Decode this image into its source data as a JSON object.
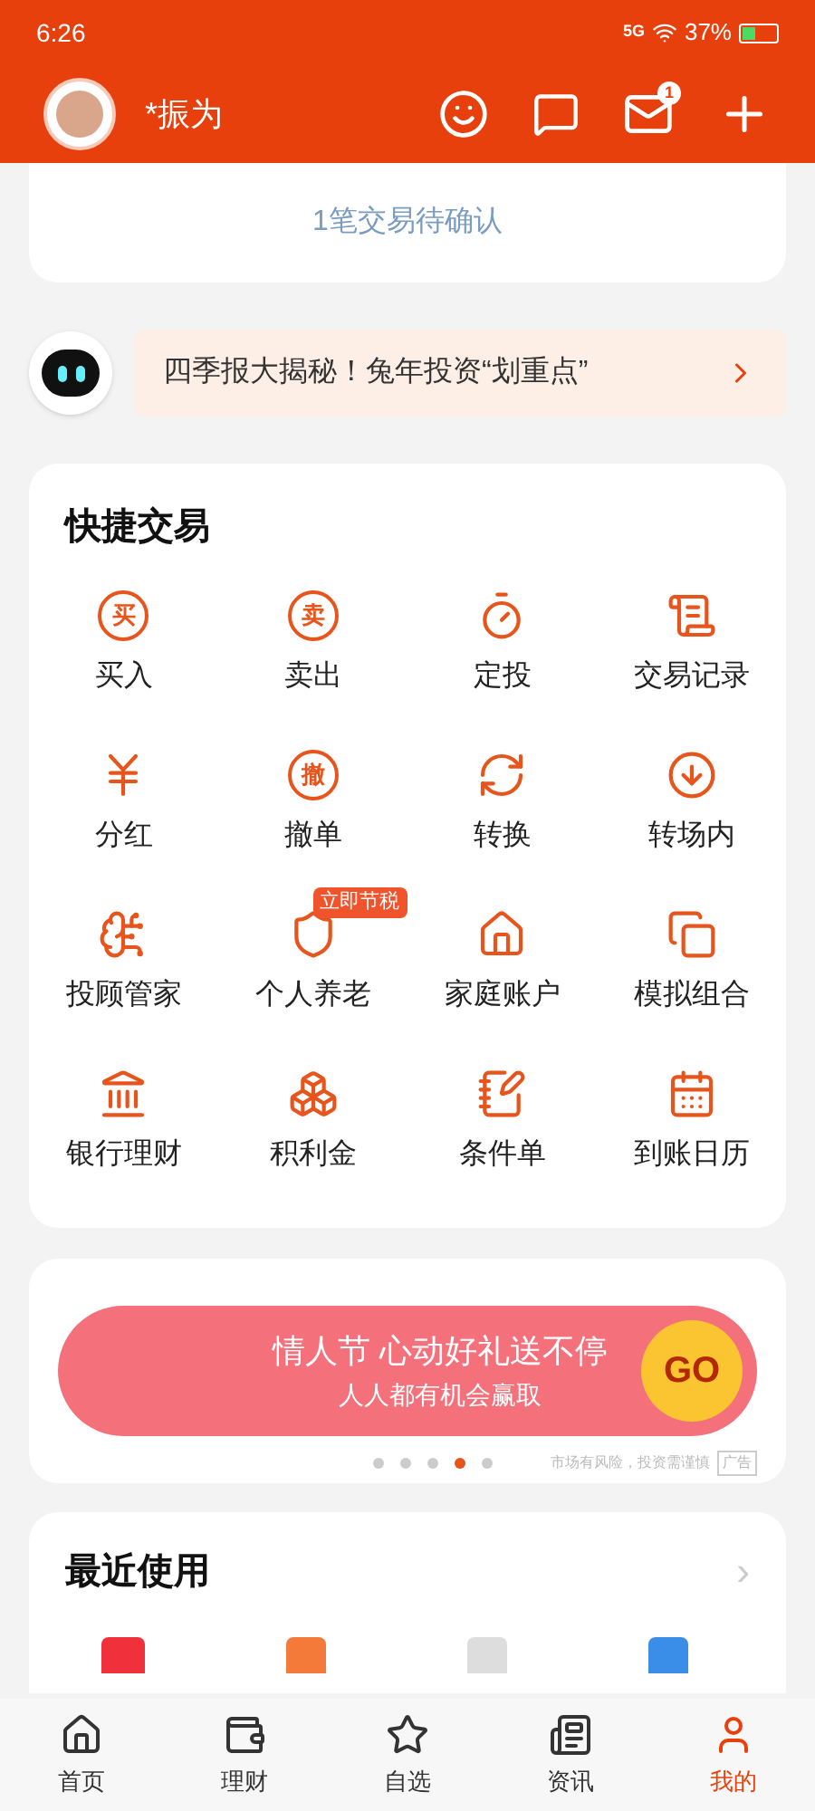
{
  "status_bar": {
    "time": "6:26",
    "network": "5G",
    "battery": "37%"
  },
  "header": {
    "username": "*振为",
    "mail_badge": "1"
  },
  "pending_card": {
    "text": "1笔交易待确认"
  },
  "robot_banner": {
    "text": "四季报大揭秘！兔年投资“划重点”"
  },
  "quick_trade": {
    "title": "快捷交易",
    "items": [
      {
        "label": "买入",
        "kind": "glyph",
        "glyph": "买"
      },
      {
        "label": "卖出",
        "kind": "glyph",
        "glyph": "卖"
      },
      {
        "label": "定投",
        "kind": "icon"
      },
      {
        "label": "交易记录",
        "kind": "icon"
      },
      {
        "label": "分红",
        "kind": "icon"
      },
      {
        "label": "撤单",
        "kind": "glyph",
        "glyph": "撤"
      },
      {
        "label": "转换",
        "kind": "icon"
      },
      {
        "label": "转场内",
        "kind": "icon"
      },
      {
        "label": "投顾管家",
        "kind": "icon"
      },
      {
        "label": "个人养老",
        "kind": "icon",
        "badge": "立即节税"
      },
      {
        "label": "家庭账户",
        "kind": "icon"
      },
      {
        "label": "模拟组合",
        "kind": "icon"
      },
      {
        "label": "银行理财",
        "kind": "icon"
      },
      {
        "label": "积利金",
        "kind": "icon"
      },
      {
        "label": "条件单",
        "kind": "icon"
      },
      {
        "label": "到账日历",
        "kind": "icon"
      }
    ]
  },
  "ad_banner": {
    "title": "情人节 心动好礼送不停",
    "subtitle": "人人都有机会赢取",
    "button": "GO",
    "disclaimer": "市场有风险，投资需谨慎",
    "tag": "广告",
    "dots": [
      {
        "selected": false
      },
      {
        "selected": false
      },
      {
        "selected": false
      },
      {
        "selected": true
      },
      {
        "selected": false
      }
    ]
  },
  "recent": {
    "title": "最近使用",
    "arrow": "›"
  },
  "bottom_nav": [
    {
      "label": "首页",
      "selected": false
    },
    {
      "label": "理财",
      "selected": false
    },
    {
      "label": "自选",
      "selected": false
    },
    {
      "label": "资讯",
      "selected": false
    },
    {
      "label": "我的",
      "selected": true
    }
  ]
}
